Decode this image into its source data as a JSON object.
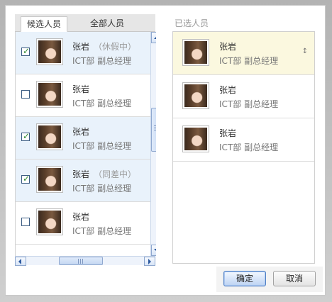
{
  "tabs": {
    "candidates": "候选人员",
    "all": "全部人员"
  },
  "candidates": [
    {
      "name": "张岩",
      "status": "（休假中）",
      "title": "ICT部 副总经理",
      "checked": true
    },
    {
      "name": "张岩",
      "status": "",
      "title": "ICT部 副总经理",
      "checked": false
    },
    {
      "name": "张岩",
      "status": "",
      "title": "ICT部 副总经理",
      "checked": true
    },
    {
      "name": "张岩",
      "status": "（同差中）",
      "title": "ICT部 副总经理",
      "checked": true
    },
    {
      "name": "张岩",
      "status": "",
      "title": "ICT部 副总经理",
      "checked": false
    }
  ],
  "selected": {
    "heading": "已选人员",
    "items": [
      {
        "name": "张岩",
        "title": "ICT部 副总经理"
      },
      {
        "name": "张岩",
        "title": "ICT部 副总经理"
      },
      {
        "name": "张岩",
        "title": "ICT部 副总经理"
      }
    ]
  },
  "buttons": {
    "ok": "确定",
    "cancel": "取消"
  },
  "colors": {
    "checked_row": "#e9f2fb",
    "selected_highlight": "#fbf8df",
    "accent": "#4f7fc3"
  },
  "icons": {
    "check": "✓",
    "reorder": "↕"
  }
}
